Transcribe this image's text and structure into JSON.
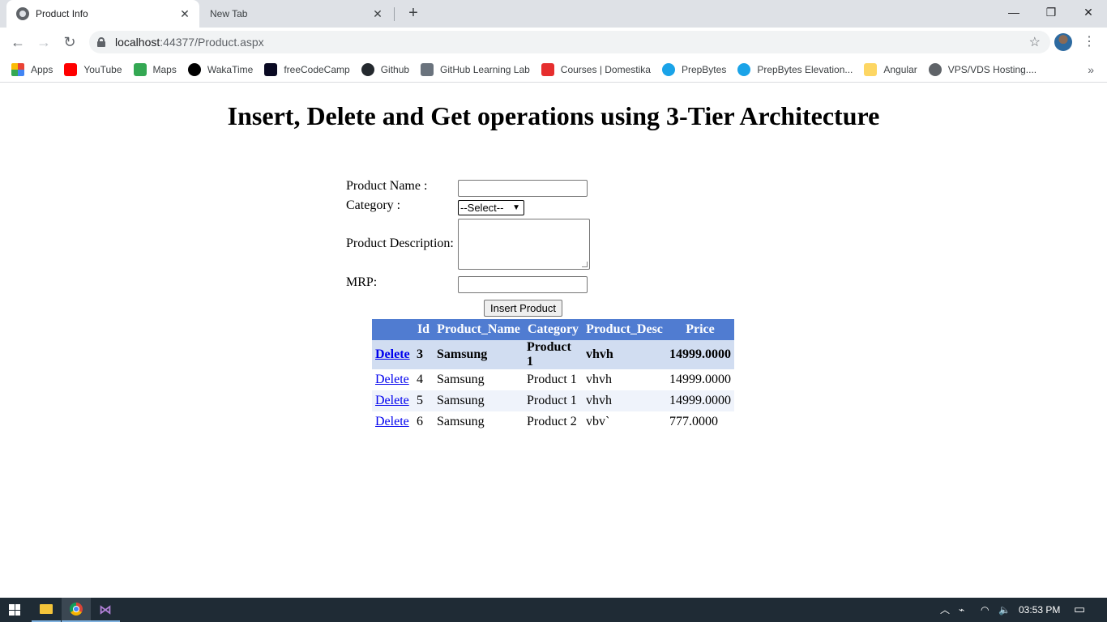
{
  "browser": {
    "tabs": [
      {
        "title": "Product Info",
        "active": true
      },
      {
        "title": "New Tab",
        "active": false
      }
    ],
    "url": {
      "host": "localhost",
      "rest": ":44377/Product.aspx"
    },
    "bookmarks": [
      {
        "label": "Apps",
        "icon": "apps-grid-icon",
        "color": "#e8710a"
      },
      {
        "label": "YouTube",
        "icon": "youtube-icon",
        "color": "#ff0000"
      },
      {
        "label": "Maps",
        "icon": "maps-icon",
        "color": "#34a853"
      },
      {
        "label": "WakaTime",
        "icon": "wakatime-icon",
        "color": "#000000"
      },
      {
        "label": "freeCodeCamp",
        "icon": "freecodecamp-icon",
        "color": "#0a0a23"
      },
      {
        "label": "Github",
        "icon": "github-icon",
        "color": "#24292e"
      },
      {
        "label": "GitHub Learning Lab",
        "icon": "github-lab-icon",
        "color": "#6a737d"
      },
      {
        "label": "Courses | Domestika",
        "icon": "domestika-icon",
        "color": "#e62e2e"
      },
      {
        "label": "PrepBytes",
        "icon": "prepbytes-icon",
        "color": "#1aa3e8"
      },
      {
        "label": "PrepBytes Elevation...",
        "icon": "prepbytes-icon",
        "color": "#1aa3e8"
      },
      {
        "label": "Angular",
        "icon": "folder-icon",
        "color": "#fdd663"
      },
      {
        "label": "VPS/VDS Hosting....",
        "icon": "globe-icon",
        "color": "#5f6368"
      }
    ]
  },
  "page": {
    "title": "Insert, Delete and Get operations using 3-Tier Architecture",
    "form": {
      "product_name_label": "Product Name :",
      "category_label": "Category :",
      "category_selected": "--Select--",
      "description_label": "Product Description:",
      "mrp_label": "MRP:",
      "insert_button": "Insert Product"
    },
    "table": {
      "headers": [
        "",
        "Id",
        "Product_Name",
        "Category",
        "Product_Desc",
        "Price"
      ],
      "delete_label": "Delete",
      "rows": [
        {
          "id": "3",
          "name": "Samsung",
          "category": "Product 1",
          "desc": "vhvh",
          "price": "14999.0000",
          "style": "selected"
        },
        {
          "id": "4",
          "name": "Samsung",
          "category": "Product 1",
          "desc": "vhvh",
          "price": "14999.0000",
          "style": "plain"
        },
        {
          "id": "5",
          "name": "Samsung",
          "category": "Product 1",
          "desc": "vhvh",
          "price": "14999.0000",
          "style": "alt"
        },
        {
          "id": "6",
          "name": "Samsung",
          "category": "Product 2",
          "desc": "vbv`",
          "price": "777.0000",
          "style": "plain"
        }
      ]
    }
  },
  "taskbar": {
    "time": "03:53 PM"
  }
}
